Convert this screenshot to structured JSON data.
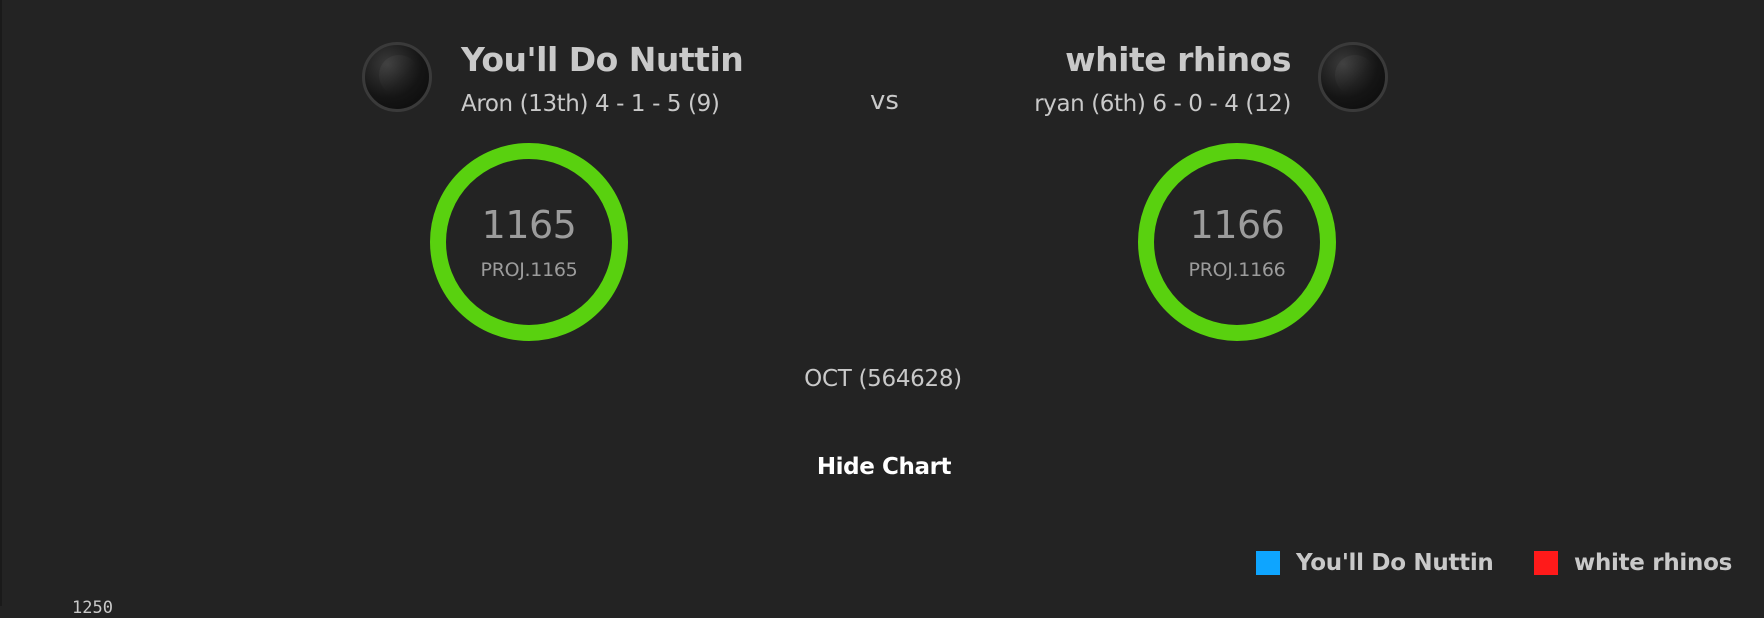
{
  "matchup": {
    "left_team": {
      "name": "You'll Do Nuttin",
      "record": "Aron (13th) 4 - 1 - 5 (9)",
      "score": "1165",
      "projected": "PROJ.1165"
    },
    "vs_label": "vs",
    "right_team": {
      "name": "white rhinos",
      "record": "ryan (6th) 6 - 0 - 4 (12)",
      "score": "1166",
      "projected": "PROJ.1166"
    },
    "period": "OCT (564628)",
    "toggle_chart_label": "Hide Chart"
  },
  "chart": {
    "legend": [
      {
        "label": "You'll Do Nuttin",
        "color": "#0ea5ff"
      },
      {
        "label": "white rhinos",
        "color": "#ff1a1a"
      }
    ],
    "first_y_tick": "1250"
  },
  "colors": {
    "ring": "#59d10f",
    "background": "#232323"
  }
}
